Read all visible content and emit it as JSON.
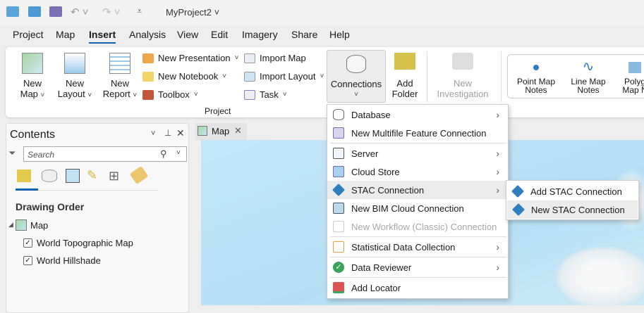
{
  "title": "MyProject2",
  "menu_tabs": [
    "Project",
    "Map",
    "Insert",
    "Analysis",
    "View",
    "Edit",
    "Imagery",
    "Share",
    "Help"
  ],
  "active_tab": "Insert",
  "ribbon": {
    "new_map": [
      "New",
      "Map"
    ],
    "new_layout": [
      "New",
      "Layout"
    ],
    "new_report": [
      "New",
      "Report"
    ],
    "new_presentation": "New Presentation",
    "new_notebook": "New Notebook",
    "toolbox": "Toolbox",
    "import_map": "Import Map",
    "import_layout": "Import Layout",
    "task": "Task",
    "group_project": "Project",
    "connections": "Connections",
    "add_folder": [
      "Add",
      "Folder"
    ],
    "new_investigation": [
      "New",
      "Investigation"
    ],
    "point_map_notes": [
      "Point Map",
      "Notes"
    ],
    "line_map_notes": [
      "Line Map",
      "Notes"
    ],
    "polygon_map_notes": [
      "Polyg",
      "Map N"
    ]
  },
  "contents": {
    "title": "Contents",
    "search_placeholder": "Search",
    "heading": "Drawing Order",
    "map": "Map",
    "layers": [
      "World Topographic Map",
      "World Hillshade"
    ]
  },
  "map_tab": "Map",
  "connections_menu": [
    {
      "label": "Database",
      "submenu": true
    },
    {
      "label": "New Multifile Feature Connection"
    },
    {
      "label": "Server",
      "submenu": true
    },
    {
      "label": "Cloud Store",
      "submenu": true
    },
    {
      "label": "STAC Connection",
      "submenu": true
    },
    {
      "label": "New BIM Cloud Connection"
    },
    {
      "label": "New Workflow (Classic) Connection",
      "disabled": true
    },
    {
      "label": "Statistical Data Collection",
      "submenu": true
    },
    {
      "label": "Data Reviewer",
      "submenu": true
    },
    {
      "label": "Add Locator"
    }
  ],
  "stac_submenu": [
    "Add STAC Connection",
    "New STAC Connection"
  ],
  "colors": {
    "accent": "#0f62ae",
    "highlight": "#ececec",
    "map_water": "#bfe3f5"
  }
}
